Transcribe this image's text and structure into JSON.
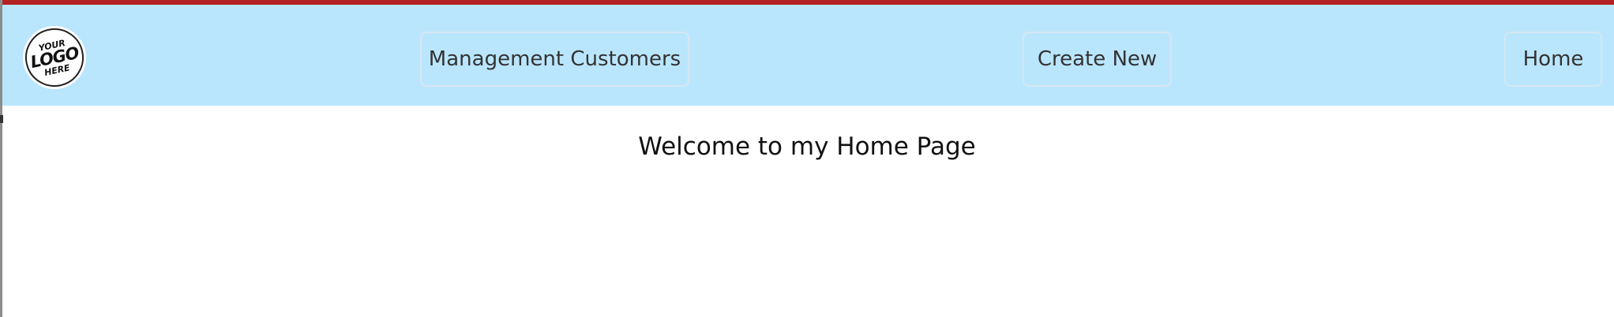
{
  "colors": {
    "navbar_background": "#bae6fd",
    "top_strip": "#b22222",
    "button_border": "#d5e6f1",
    "text": "#333333"
  },
  "navbar": {
    "logo": {
      "icon": "logo-badge-icon",
      "line1": "YOUR",
      "line2": "LOGO",
      "line3": "HERE"
    },
    "buttons": [
      {
        "label": "Management Customers"
      },
      {
        "label": "Create New"
      },
      {
        "label": "Home"
      }
    ]
  },
  "main": {
    "heading": "Welcome to my Home Page"
  }
}
